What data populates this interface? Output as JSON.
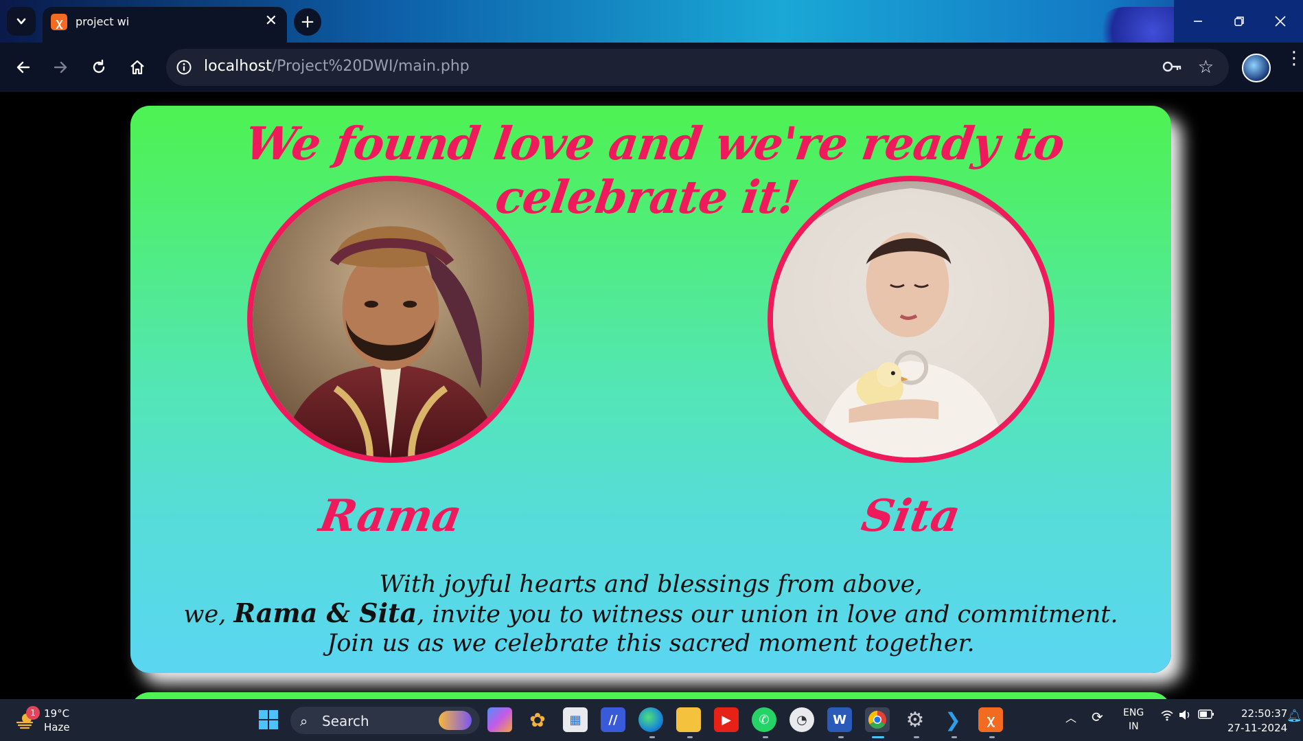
{
  "browser": {
    "tab_title": "project wi",
    "url_host": "localhost",
    "url_path": "/Project%20DWI/main.php"
  },
  "page": {
    "headline": "We found love and we're ready to celebrate it!",
    "groom_name": "Rama",
    "bride_name": "Sita",
    "invite_line1": "With joyful hearts and blessings from above,",
    "invite_pre": "we, ",
    "invite_couple": "Rama & Sita",
    "invite_post": ", invite you to witness our union in love and commitment. Join us as we celebrate this sacred moment together.",
    "accent_color": "#ef1a5b"
  },
  "taskbar": {
    "weather_badge": "1",
    "temperature": "19°C",
    "weather": "Haze",
    "search_label": "Search",
    "lang_line1": "ENG",
    "lang_line2": "IN",
    "time": "22:50:37",
    "date": "27-11-2024"
  }
}
